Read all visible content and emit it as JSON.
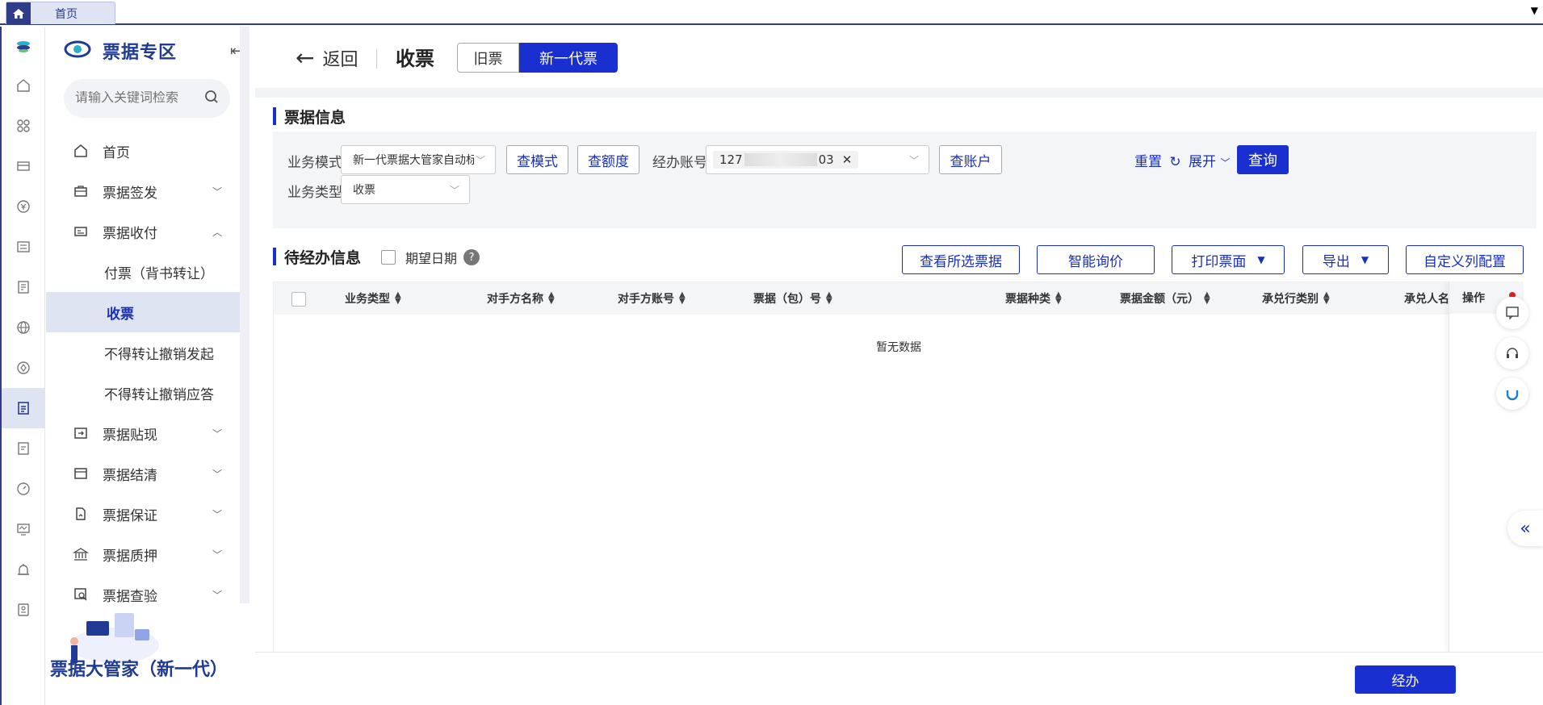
{
  "topbar": {
    "home_tab": "首页"
  },
  "brand": {
    "title": "票据专区"
  },
  "search": {
    "placeholder": "请输入关键词检索"
  },
  "menu": {
    "items": [
      {
        "label": "首页",
        "icon": "home-icon"
      },
      {
        "label": "票据签发",
        "icon": "briefcase-icon"
      },
      {
        "label": "票据收付",
        "icon": "card-icon"
      },
      {
        "label": "付票（背书转让）"
      },
      {
        "label": "收票"
      },
      {
        "label": "不得转让撤销发起"
      },
      {
        "label": "不得转让撤销应答"
      },
      {
        "label": "票据贴现",
        "icon": "login-icon"
      },
      {
        "label": "票据结清",
        "icon": "window-icon"
      },
      {
        "label": "票据保证",
        "icon": "document-icon"
      },
      {
        "label": "票据质押",
        "icon": "bank-icon"
      },
      {
        "label": "票据查验",
        "icon": "inspect-icon"
      }
    ]
  },
  "promo": {
    "text": "票据大管家（新一代）"
  },
  "header": {
    "back": "返回",
    "title": "收票",
    "seg_old": "旧票",
    "seg_new": "新一代票"
  },
  "section1": {
    "title": "票据信息"
  },
  "filter": {
    "mode_label": "业务模式",
    "mode_value": "新一代票据大管家自动标准",
    "btn_mode": "查模式",
    "btn_quota": "查额度",
    "account_label": "经办账号",
    "account_prefix": "127",
    "account_suffix": "03",
    "btn_account": "查账户",
    "reset": "重置",
    "expand": "展开",
    "query": "查询",
    "type_label": "业务类型",
    "type_value": "收票"
  },
  "section2": {
    "title": "待经办信息",
    "expect_date": "期望日期",
    "help": "?"
  },
  "ops": {
    "view_selected": "查看所选票据",
    "smart_quote": "智能询价",
    "print": "打印票面",
    "export": "导出",
    "custom_cols": "自定义列配置"
  },
  "table": {
    "columns": [
      "业务类型",
      "对手方名称",
      "对手方账号",
      "票据（包）号",
      "票据种类",
      "票据金额（元）",
      "承兑行类别",
      "承兑人名"
    ],
    "op_column": "操作",
    "empty": "暂无数据"
  },
  "footer": {
    "go": "经办"
  }
}
